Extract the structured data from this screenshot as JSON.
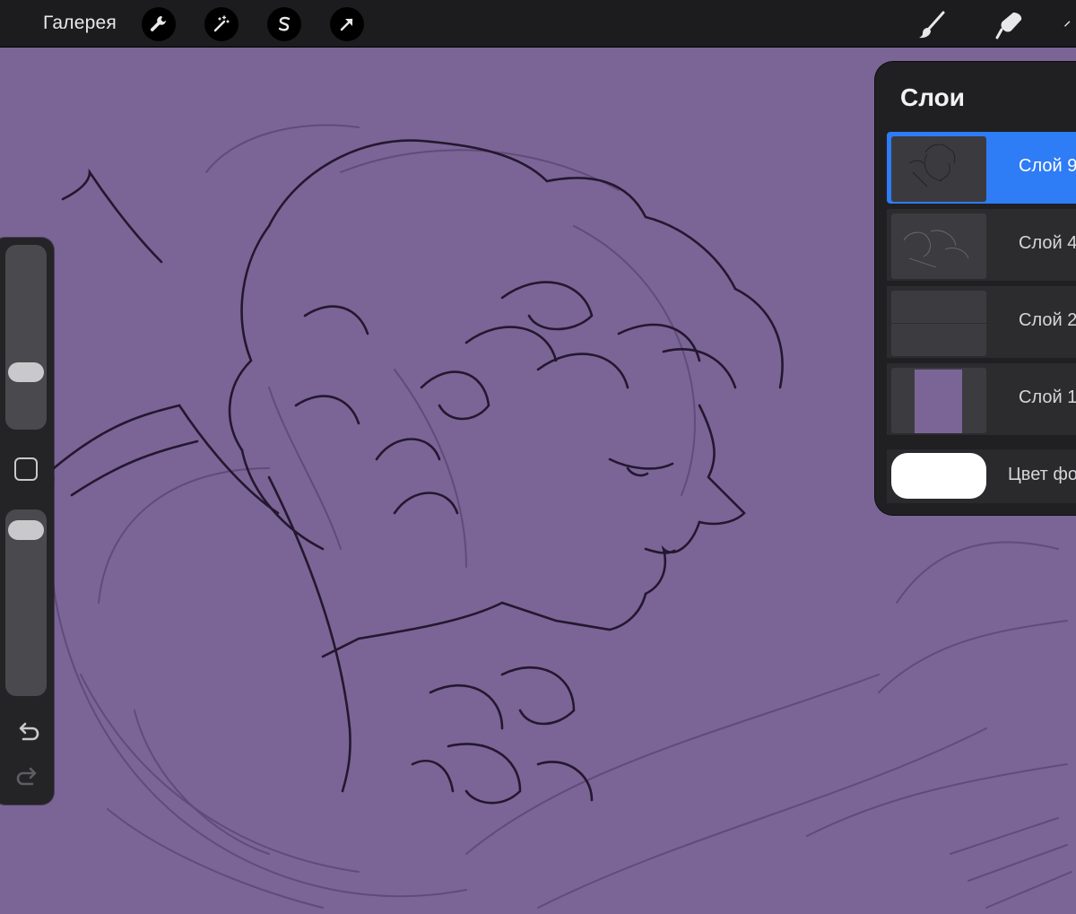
{
  "topbar": {
    "gallery_label": "Галерея",
    "tools": [
      {
        "icon": "wrench-icon"
      },
      {
        "icon": "magic-wand-icon"
      },
      {
        "icon": "selection-s-icon"
      },
      {
        "icon": "transform-arrow-icon"
      }
    ],
    "right_tools": [
      {
        "icon": "brush-icon"
      },
      {
        "icon": "smudge-icon"
      }
    ]
  },
  "sidebar": {
    "brush_size_level": 0.28,
    "opacity_level": 0.95
  },
  "layers": {
    "title": "Слои",
    "items": [
      {
        "label": "Слой 9",
        "selected": true
      },
      {
        "label": "Слой 4",
        "selected": false
      },
      {
        "label": "Слой 2",
        "selected": false
      },
      {
        "label": "Слой 1",
        "selected": false
      }
    ],
    "background_label": "Цвет фона",
    "background_color": "#ffffff"
  },
  "colors": {
    "canvas": "#7a6596",
    "accent": "#2e7cf6",
    "bar": "#1c1c1e"
  }
}
